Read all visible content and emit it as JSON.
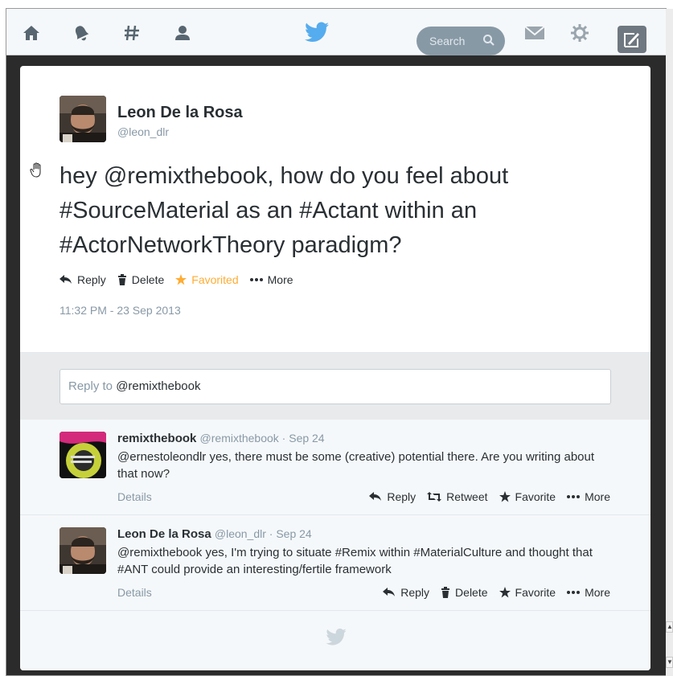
{
  "topbar": {
    "search_placeholder": "Search",
    "icons": [
      "home-icon",
      "notifications-icon",
      "discover-icon",
      "me-icon",
      "twitter-bird-icon",
      "messages-icon",
      "settings-icon",
      "compose-icon"
    ]
  },
  "tweet": {
    "author_name": "Leon De la Rosa",
    "author_handle": "@leon_dlr",
    "text": "hey @remixthebook, how do you feel about #SourceMaterial as an #Actant within an #ActorNetworkTheory paradigm?",
    "actions": {
      "reply": "Reply",
      "delete": "Delete",
      "favorited": "Favorited",
      "more": "More"
    },
    "timestamp": "11:32 PM - 23 Sep 2013"
  },
  "reply_box": {
    "prefix": "Reply to ",
    "mention": "@remixthebook"
  },
  "replies": [
    {
      "author_name": "remixthebook",
      "meta": "@remixthebook · Sep 24",
      "text": "@ernestoleondlr yes, there must be some (creative) potential there. Are you writing about that now?",
      "details": "Details",
      "actions": {
        "reply": "Reply",
        "retweet": "Retweet",
        "favorite": "Favorite",
        "more": "More"
      }
    },
    {
      "author_name": "Leon De la Rosa",
      "meta": "@leon_dlr · Sep 24",
      "text": "@remixthebook yes, I'm trying to situate #Remix within #MaterialCulture and thought that #ANT could provide an interesting/fertile framework",
      "details": "Details",
      "actions": {
        "reply": "Reply",
        "delete": "Delete",
        "favorite": "Favorite",
        "more": "More"
      }
    }
  ],
  "colors": {
    "brand_blue": "#55acee",
    "favorite_orange": "#ffac33",
    "muted_text": "#8899a6"
  }
}
